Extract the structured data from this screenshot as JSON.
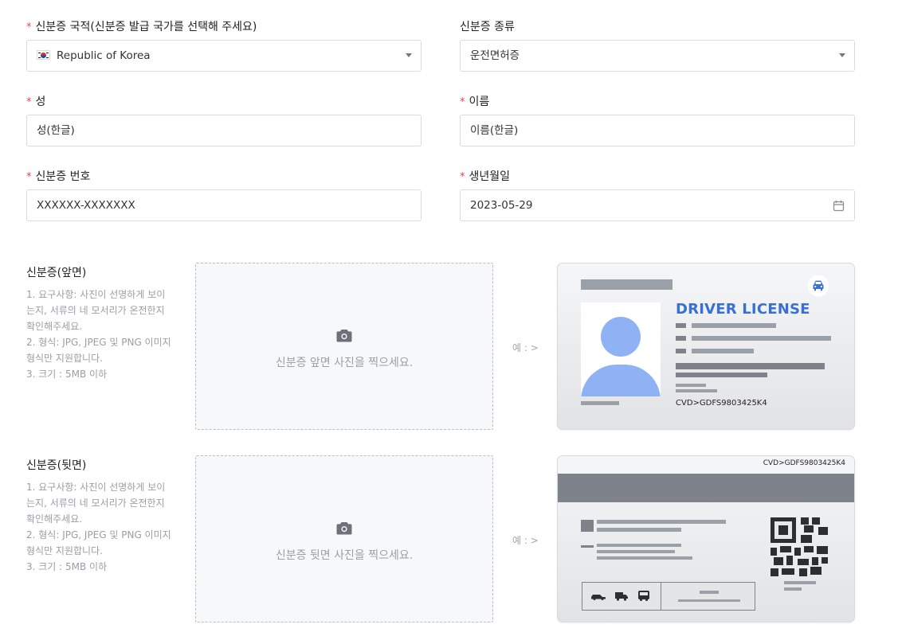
{
  "form": {
    "nationality": {
      "label": "신분증 국적(신분증 발급 국가를 선택해 주세요)",
      "value": "Republic of Korea",
      "required": "*"
    },
    "id_type": {
      "label": "신분증 종류",
      "value": "운전면허증"
    },
    "last_name": {
      "label": "성",
      "placeholder": "성(한글)",
      "required": "*"
    },
    "first_name": {
      "label": "이름",
      "placeholder": "이름(한글)",
      "required": "*"
    },
    "id_number": {
      "label": "신분증 번호",
      "value": "XXXXXX-XXXXXXX",
      "required": "*"
    },
    "birthdate": {
      "label": "생년월일",
      "value": "2023-05-29",
      "required": "*"
    }
  },
  "front": {
    "title": "신분증(앞면)",
    "requirements": "1. 요구사항: 사진이 선명하게 보이\n는지, 서류의 네 모서리가 온전한지\n확인해주세요.\n2. 형식: JPG, JPEG 및 PNG 이미지\n형식만 지원합니다.\n3. 크기 : 5MB 이하",
    "upload_text": "신분증 앞면 사진을 찍으세요.",
    "example_label": "예 : >",
    "card_title": "DRIVER LICENSE",
    "card_code": "CVD>GDFS9803425K4"
  },
  "back": {
    "title": "신분증(뒷면)",
    "requirements": "1. 요구사항: 사진이 선명하게 보이\n는지, 서류의 네 모서리가 온전한지\n확인해주세요.\n2. 형식: JPG, JPEG 및 PNG 이미지\n형식만 지원합니다.\n3. 크기 : 5MB 이하",
    "upload_text": "신분증 뒷면 사진을 찍으세요.",
    "example_label": "예 : >",
    "card_code": "CVD>GDFS9803425K4"
  },
  "colors": {
    "required": "#e5484d",
    "accent": "#3a6fd3",
    "photo_blue": "#8fb2f5"
  }
}
